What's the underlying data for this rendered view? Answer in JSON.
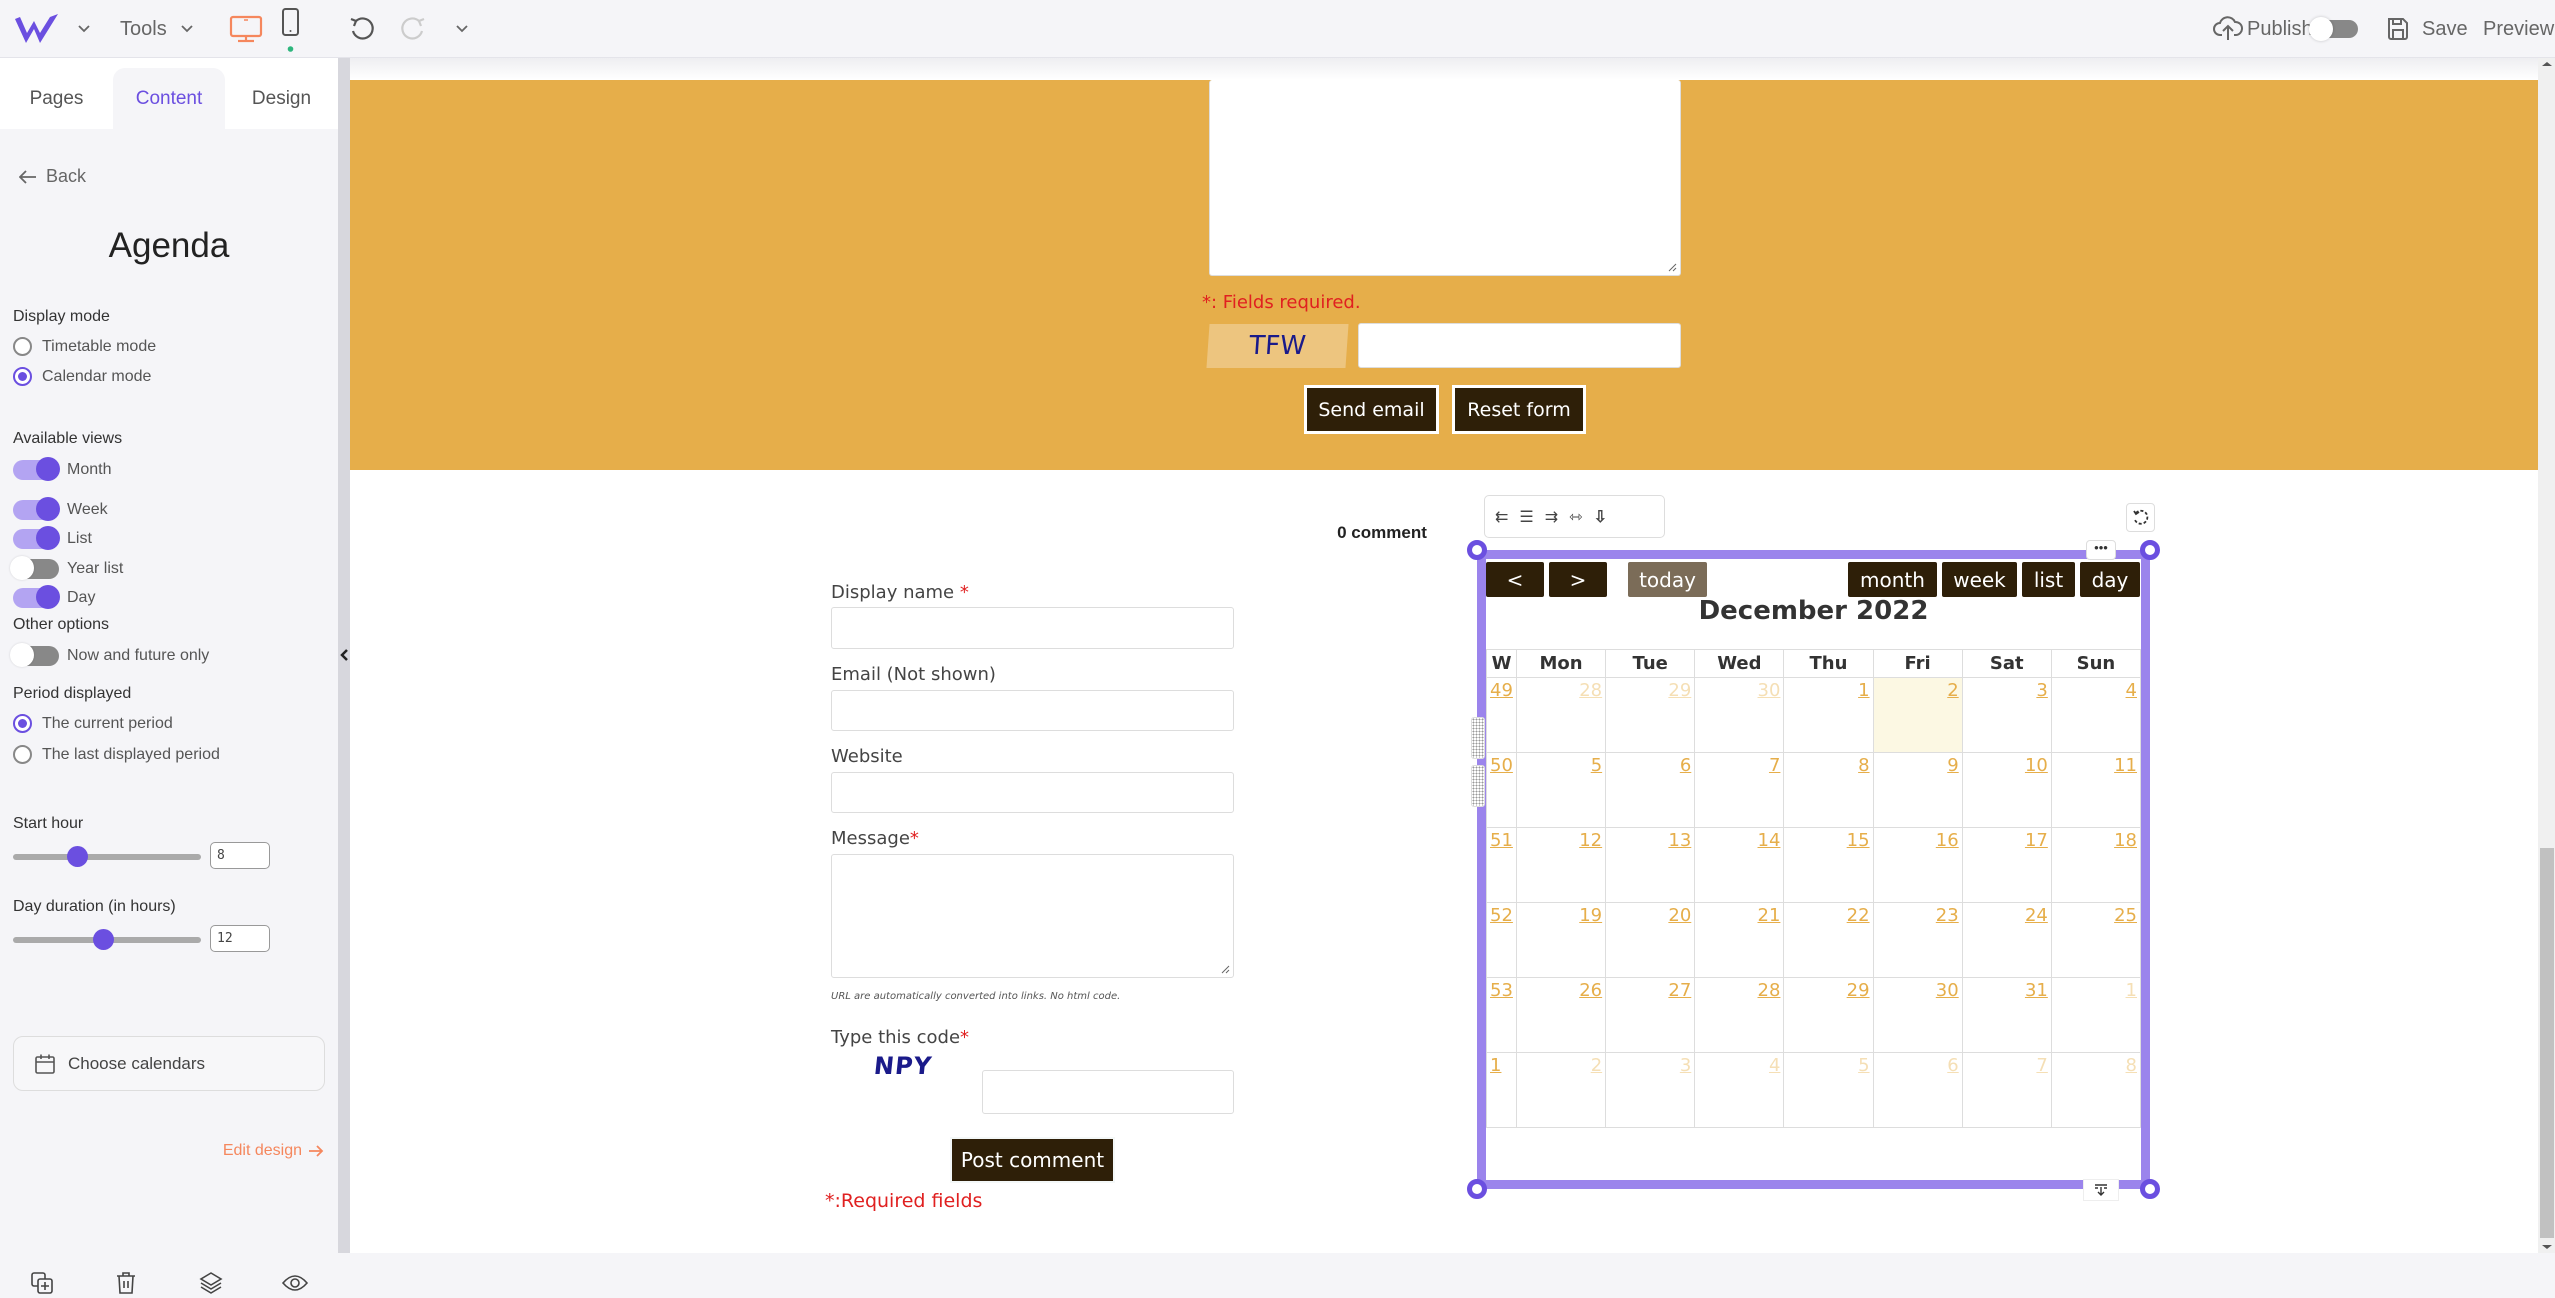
{
  "topbar": {
    "logo": "W",
    "tools_label": "Tools",
    "device_desktop": "desktop-icon",
    "device_mobile": "mobile-icon",
    "undo": "undo-icon",
    "redo": "redo-icon",
    "publish_label": "Publish",
    "publish_toggle_on": false,
    "save_label": "Save",
    "preview_label": "Preview"
  },
  "sidebar": {
    "tabs": [
      {
        "label": "Pages",
        "active": false
      },
      {
        "label": "Content",
        "active": true
      },
      {
        "label": "Design",
        "active": false
      }
    ],
    "back_label": "Back",
    "title": "Agenda",
    "display_mode": {
      "label": "Display mode",
      "options": [
        {
          "label": "Timetable mode",
          "checked": false
        },
        {
          "label": "Calendar mode",
          "checked": true
        }
      ]
    },
    "available_views": {
      "label": "Available views",
      "items": [
        {
          "label": "Month",
          "on": true
        },
        {
          "label": "Week",
          "on": true
        },
        {
          "label": "List",
          "on": true
        },
        {
          "label": "Year list",
          "on": false
        },
        {
          "label": "Day",
          "on": true
        }
      ]
    },
    "other_options": {
      "label": "Other options",
      "items": [
        {
          "label": "Now and future only",
          "on": false
        }
      ]
    },
    "period_displayed": {
      "label": "Period displayed",
      "options": [
        {
          "label": "The current period",
          "checked": true
        },
        {
          "label": "The last displayed period",
          "checked": false
        }
      ]
    },
    "start_hour": {
      "label": "Start hour",
      "value": "8",
      "fraction": 0.34
    },
    "day_duration": {
      "label": "Day duration (in hours)",
      "value": "12",
      "fraction": 0.48
    },
    "choose_calendars_label": "Choose calendars",
    "edit_design_label": "Edit design"
  },
  "contact_form": {
    "fields_required": "*: Fields required.",
    "captcha_code": "TFW",
    "captcha_input_value": "",
    "send_label": "Send email",
    "reset_label": "Reset form"
  },
  "comment_form": {
    "count_label": "0 comment",
    "display_name_label": "Display name ",
    "email_label": "Email (Not shown)",
    "website_label": "Website",
    "message_label": "Message",
    "hint": "URL are automatically converted into links. No html code.",
    "code_label": "Type this code",
    "captcha_code": "NPY",
    "post_label": "Post comment",
    "required_note": "*:Required fields",
    "req_marker": "*"
  },
  "calendar": {
    "prev_label": "<",
    "next_label": ">",
    "today_label": "today",
    "views": [
      "month",
      "week",
      "list",
      "day"
    ],
    "title": "December 2022",
    "headers": [
      "W",
      "Mon",
      "Tue",
      "Wed",
      "Thu",
      "Fri",
      "Sat",
      "Sun"
    ],
    "weeks": [
      {
        "wk": "49",
        "days": [
          {
            "d": "28",
            "o": true
          },
          {
            "d": "29",
            "o": true
          },
          {
            "d": "30",
            "o": true
          },
          {
            "d": "1"
          },
          {
            "d": "2",
            "today": true
          },
          {
            "d": "3"
          },
          {
            "d": "4"
          }
        ]
      },
      {
        "wk": "50",
        "days": [
          {
            "d": "5"
          },
          {
            "d": "6"
          },
          {
            "d": "7"
          },
          {
            "d": "8"
          },
          {
            "d": "9"
          },
          {
            "d": "10"
          },
          {
            "d": "11"
          }
        ]
      },
      {
        "wk": "51",
        "days": [
          {
            "d": "12"
          },
          {
            "d": "13"
          },
          {
            "d": "14"
          },
          {
            "d": "15"
          },
          {
            "d": "16"
          },
          {
            "d": "17"
          },
          {
            "d": "18"
          }
        ]
      },
      {
        "wk": "52",
        "days": [
          {
            "d": "19"
          },
          {
            "d": "20"
          },
          {
            "d": "21"
          },
          {
            "d": "22"
          },
          {
            "d": "23"
          },
          {
            "d": "24"
          },
          {
            "d": "25"
          }
        ]
      },
      {
        "wk": "53",
        "days": [
          {
            "d": "26"
          },
          {
            "d": "27"
          },
          {
            "d": "28"
          },
          {
            "d": "29"
          },
          {
            "d": "30"
          },
          {
            "d": "31"
          },
          {
            "d": "1",
            "o": true
          }
        ]
      },
      {
        "wk": "1",
        "days": [
          {
            "d": "2",
            "o": true
          },
          {
            "d": "3",
            "o": true
          },
          {
            "d": "4",
            "o": true
          },
          {
            "d": "5",
            "o": true
          },
          {
            "d": "6",
            "o": true
          },
          {
            "d": "7",
            "o": true
          },
          {
            "d": "8",
            "o": true
          }
        ]
      }
    ]
  },
  "colors": {
    "accent": "#6b4fe0",
    "selection": "#9b84ec",
    "band": "#e6ae4a",
    "button_dark": "#2e1f08",
    "required_red": "#e02020",
    "edit_design": "#f5875d"
  }
}
